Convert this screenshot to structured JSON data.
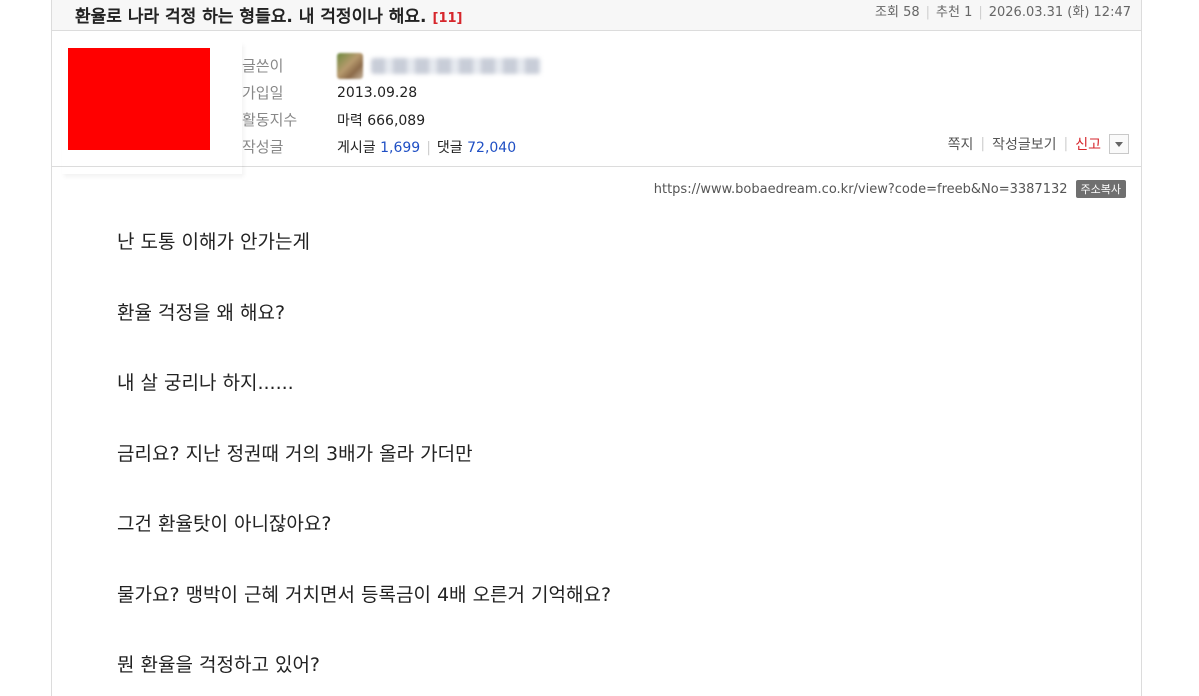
{
  "post": {
    "title": "환율로 나라 걱정 하는 형들요. 내 걱정이나 해요.",
    "comment_count": "[11]",
    "views_label": "조회",
    "views": "58",
    "recommend_label": "추천",
    "recommend": "1",
    "datetime": "2026.03.31 (화) 12:47"
  },
  "author": {
    "labels": {
      "writer": "글쓴이",
      "joined": "가입일",
      "activity": "활동지수",
      "posts": "작성글"
    },
    "joined": "2013.09.28",
    "activity_label": "마력",
    "activity_value": "666,089",
    "posts_label": "게시글",
    "posts_count": "1,699",
    "comments_label": "댓글",
    "comments_count": "72,040"
  },
  "actions": {
    "message": "쪽지",
    "view_posts": "작성글보기",
    "report": "신고"
  },
  "url": {
    "text": "https://www.bobaedream.co.kr/view?code=freeb&No=3387132",
    "copy_label": "주소복사"
  },
  "body": [
    "난 도통 이해가 안가는게",
    "환율 걱정을 왜 해요?",
    "내 살 궁리나 하지......",
    "금리요? 지난 정권때 거의 3배가 올라 가더만",
    "그건 환율탓이 아니잖아요?",
    "물가요? 맹박이 근혜 거치면서 등록금이 4배 오른거 기억해요?",
    "뭔 환율을 걱정하고 있어?"
  ],
  "colors": {
    "accent_red": "#d6262c",
    "link_blue": "#1f4fc4",
    "profile_placeholder": "#ff0000"
  }
}
